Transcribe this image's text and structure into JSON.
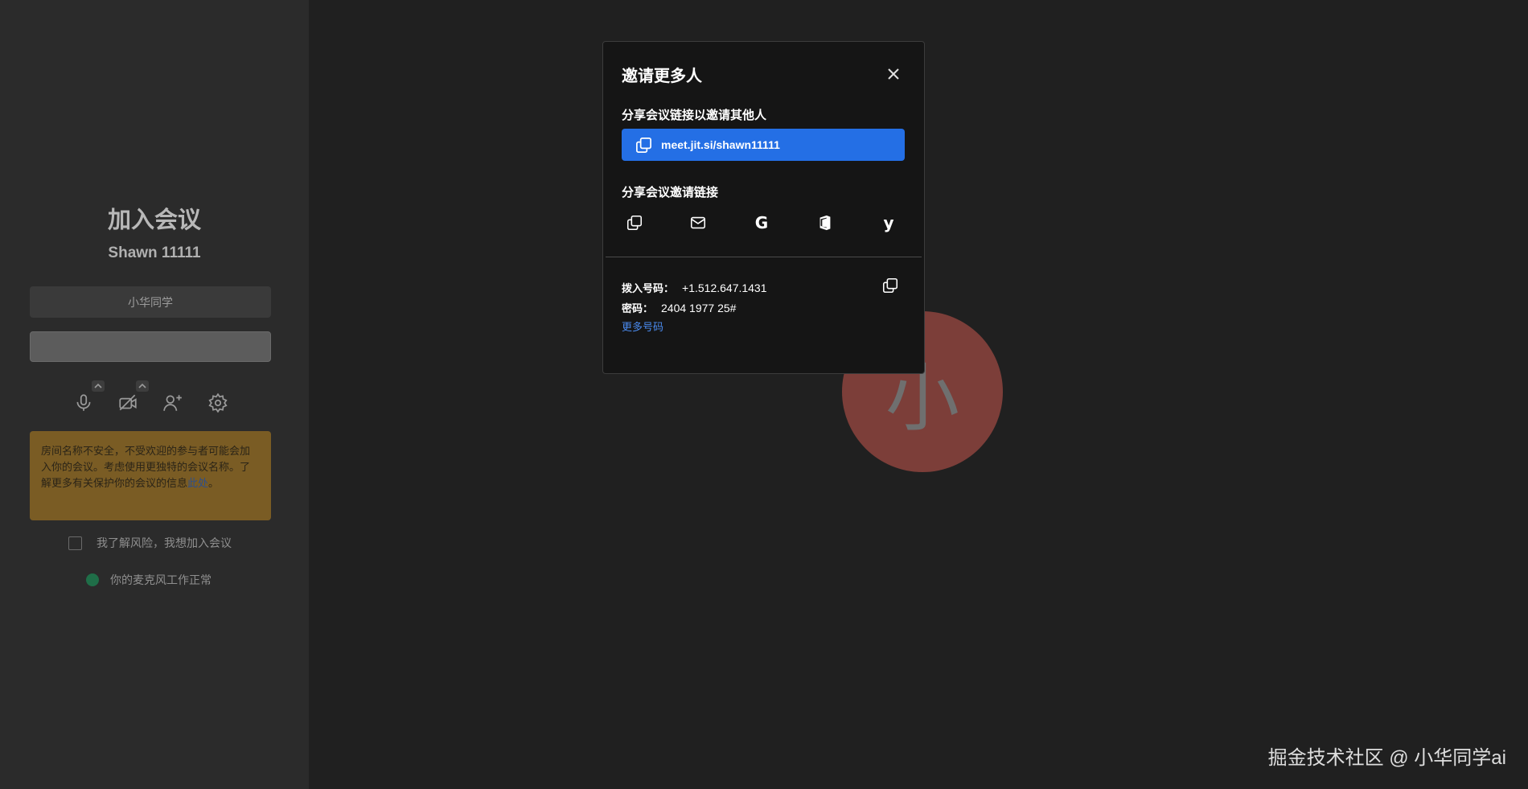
{
  "prejoin": {
    "title": "加入会议",
    "room_name": "Shawn 11111",
    "name_input_value": "小华同学",
    "join_button_label": "",
    "warning_text": "房间名称不安全，不受欢迎的参与者可能会加入你的会议。考虑使用更独特的会议名称。了解更多有关保护你的会议的信息",
    "warning_link": "此处",
    "warning_end": "。",
    "risk_checkbox_label": "我了解风险，我想加入会议",
    "mic_status": "你的麦克风工作正常",
    "tools": [
      "microphone-icon",
      "camera-off-icon",
      "invite-people-icon",
      "settings-icon"
    ]
  },
  "avatar": {
    "initial": "小",
    "color": "#7c3e39"
  },
  "dialog": {
    "title": "邀请更多人",
    "share_link_label": "分享会议链接以邀请其他人",
    "meeting_url": "meet.jit.si/shawn11111",
    "share_invite_label": "分享会议邀请链接",
    "share_options": [
      "copy-icon",
      "email-icon",
      "google-icon",
      "office365-icon",
      "yahoo-icon"
    ],
    "dial_in_label": "拨入号码：",
    "dial_in_number": "+1.512.647.1431",
    "pin_label": "密码：",
    "pin_value": "2404 1977 25#",
    "more_numbers": "更多号码"
  },
  "watermark": "掘金技术社区 @ 小华同学ai",
  "colors": {
    "accent": "#246fe5",
    "background": "#202020",
    "dialog_bg": "#151515",
    "warning_bg": "#7a5c24"
  }
}
